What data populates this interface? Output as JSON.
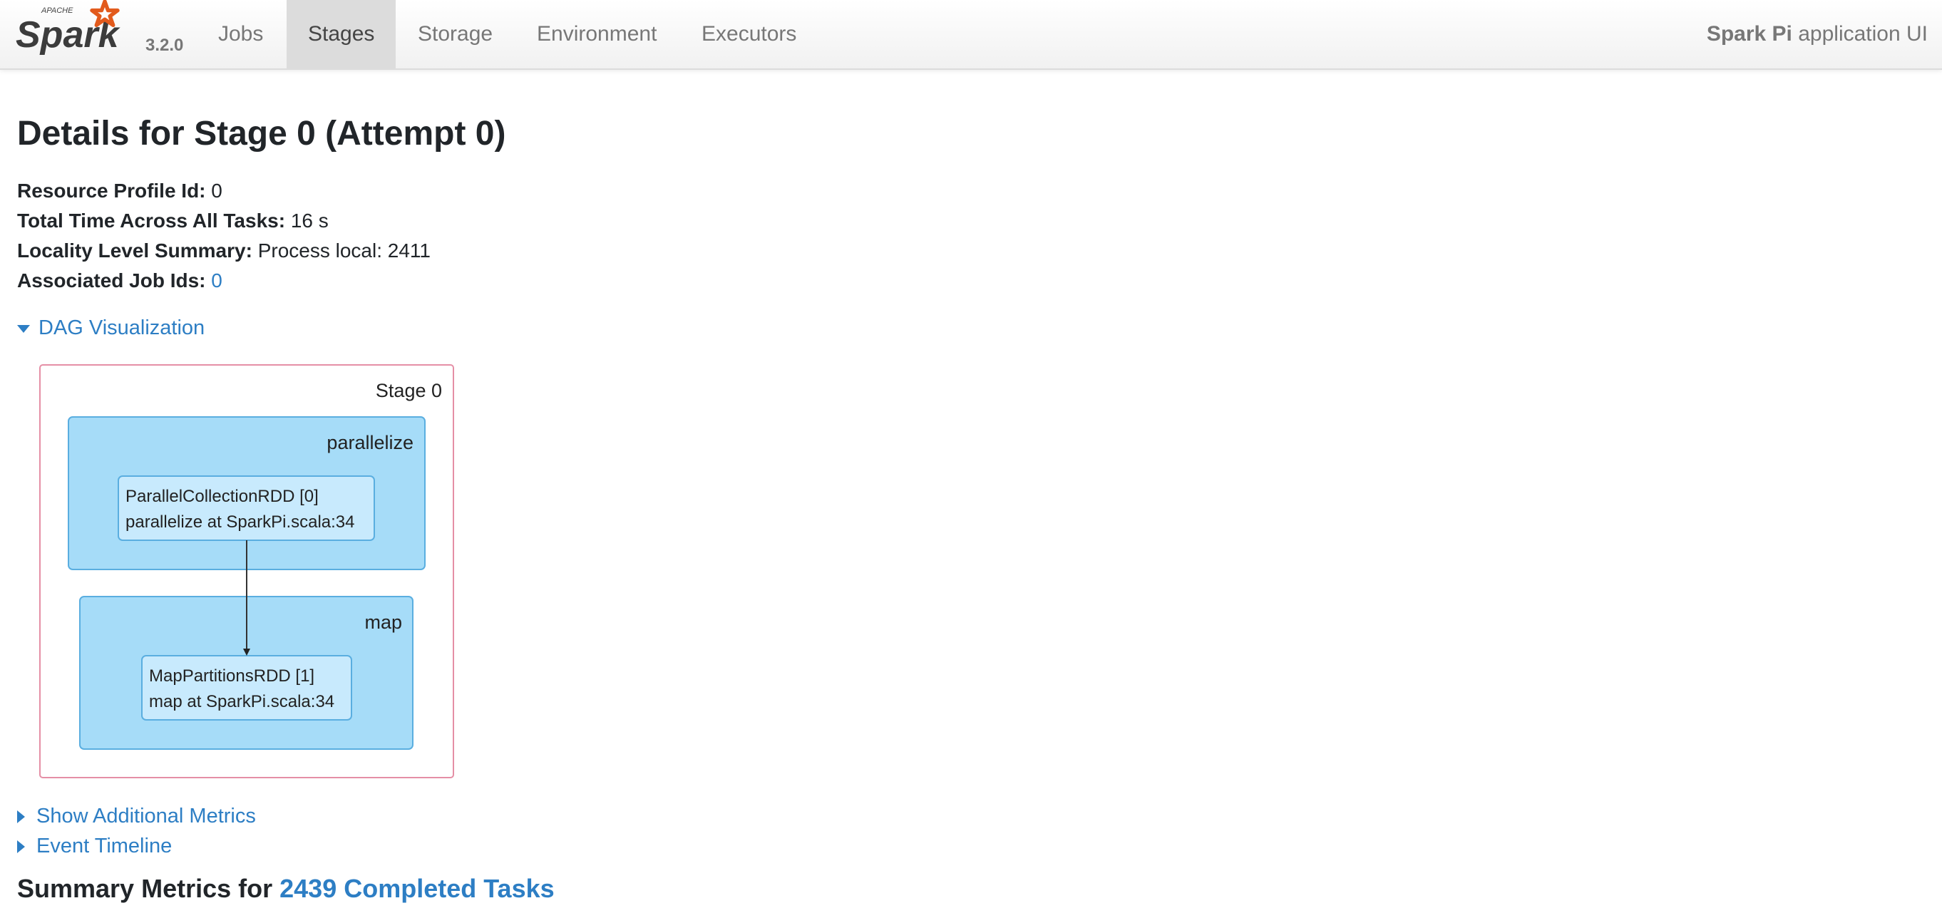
{
  "nav": {
    "brand_name": "Spark",
    "brand_apache": "APACHE",
    "version": "3.2.0",
    "tabs": [
      {
        "label": "Jobs"
      },
      {
        "label": "Stages"
      },
      {
        "label": "Storage"
      },
      {
        "label": "Environment"
      },
      {
        "label": "Executors"
      }
    ],
    "active_tab": "Stages",
    "app_name": "Spark Pi",
    "app_suffix": "application UI"
  },
  "page": {
    "title": "Details for Stage 0 (Attempt 0)",
    "summary": [
      {
        "label": "Resource Profile Id:",
        "value": "0"
      },
      {
        "label": "Total Time Across All Tasks:",
        "value": "16 s"
      },
      {
        "label": "Locality Level Summary:",
        "value": "Process local: 2411"
      },
      {
        "label": "Associated Job Ids:",
        "value": "0"
      }
    ]
  },
  "dag": {
    "toggle_label": "DAG Visualization",
    "stage_label": "Stage 0",
    "clusters": [
      {
        "label": "parallelize",
        "node_line1": "ParallelCollectionRDD [0]",
        "node_line2": "parallelize at SparkPi.scala:34"
      },
      {
        "label": "map",
        "node_line1": "MapPartitionsRDD [1]",
        "node_line2": "map at SparkPi.scala:34"
      }
    ],
    "colors": {
      "stage_border": "#e58fa6",
      "cluster_fill": "#a6dcf8",
      "cluster_border": "#5aaee0",
      "node_fill": "#c8eafd",
      "node_border": "#5aaee0",
      "edge": "#333333"
    }
  },
  "links": {
    "additional_metrics": "Show Additional Metrics",
    "event_timeline": "Event Timeline"
  },
  "summary_metrics": {
    "prefix": "Summary Metrics for",
    "link": "2439 Completed Tasks"
  }
}
